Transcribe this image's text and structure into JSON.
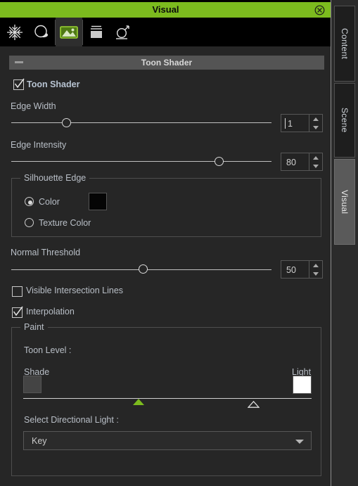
{
  "window": {
    "title": "Visual",
    "close_icon": "close-circle-icon",
    "accent_color": "#7cbb1e"
  },
  "toolbar": {
    "items": [
      {
        "icon": "snowflake-effects-icon",
        "active": false
      },
      {
        "icon": "shading-ball-icon",
        "active": false
      },
      {
        "icon": "image-texture-icon",
        "active": true
      },
      {
        "icon": "box-drawer-icon",
        "active": false
      },
      {
        "icon": "particle-emitter-icon",
        "active": false
      }
    ]
  },
  "section": {
    "header_title": "Toon Shader",
    "collapse_icon": "minus-icon",
    "enable_checkbox": {
      "label": "Toon Shader",
      "checked": true
    }
  },
  "edge_width": {
    "label": "Edge Width",
    "value": "1",
    "slider_percent": 22
  },
  "edge_intensity": {
    "label": "Edge Intensity",
    "value": "80",
    "slider_percent": 80
  },
  "silhouette_edge": {
    "title": "Silhouette Edge",
    "options": [
      {
        "label": "Color",
        "selected": true
      },
      {
        "label": "Texture Color",
        "selected": false
      }
    ],
    "color_swatch": "#050505"
  },
  "normal_threshold": {
    "label": "Normal Threshold",
    "value": "50",
    "slider_percent": 50
  },
  "checkboxes": [
    {
      "label": "Visible Intersection Lines",
      "checked": false
    },
    {
      "label": "Interpolation",
      "checked": true
    }
  ],
  "paint": {
    "title": "Paint",
    "toon_level_label": "Toon Level :",
    "shade_label": "Shade",
    "light_label": "Light",
    "shade_color": "#444444",
    "light_color": "#ffffff",
    "markers": [
      {
        "name": "shade-marker",
        "style": "filled",
        "color": "#7cbb1e",
        "percent": 42
      },
      {
        "name": "light-marker",
        "style": "outline",
        "color": "#dcdcdc",
        "percent": 82
      }
    ],
    "directional_light_label": "Select Directional Light :",
    "directional_light_value": "Key"
  },
  "tabs": [
    {
      "label": "Content",
      "active": false
    },
    {
      "label": "Scene",
      "active": false
    },
    {
      "label": "Visual",
      "active": true
    }
  ]
}
